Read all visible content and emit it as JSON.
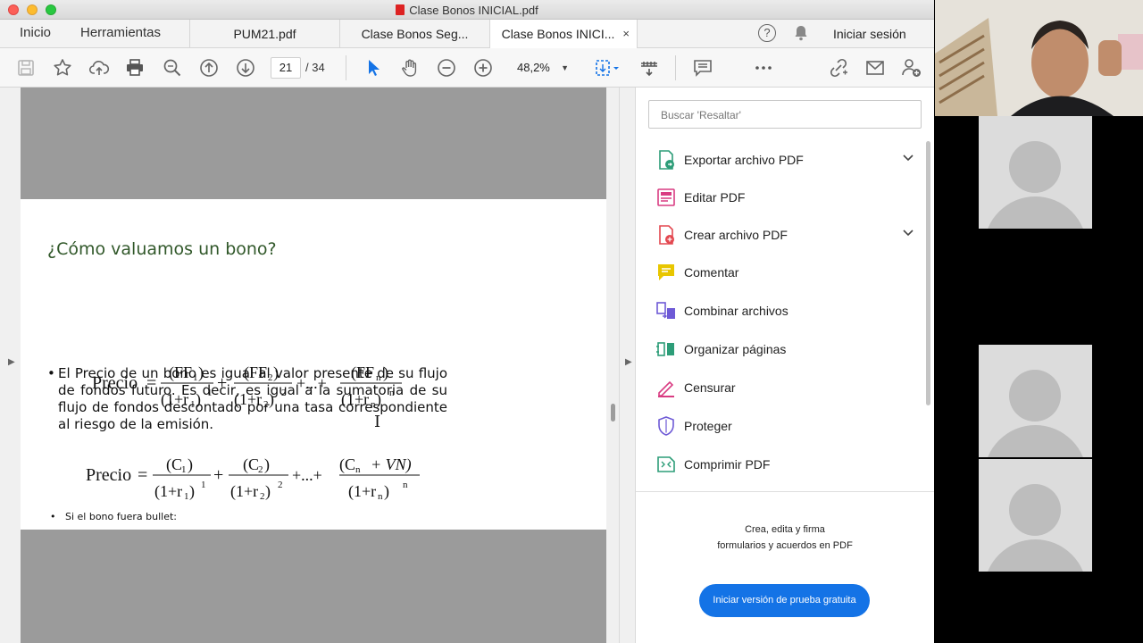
{
  "window": {
    "title": "Clase Bonos INICIAL.pdf"
  },
  "nav": {
    "home": "Inicio",
    "tools": "Herramientas"
  },
  "tabs": [
    {
      "label": "PUM21.pdf"
    },
    {
      "label": "Clase Bonos Seg..."
    },
    {
      "label": "Clase Bonos INICI...",
      "close": "×"
    }
  ],
  "account": {
    "signin": "Iniciar sesión",
    "help": "?"
  },
  "toolbar": {
    "page_current": "21",
    "page_total": "/ 34",
    "zoom": "48,2%"
  },
  "slide": {
    "title": "¿Cómo valuamos un bono?",
    "bullet_marker": "•",
    "bullet_text": "El Precio de un bono es igual al valor presente de su flujo de fondos futuro. Es decir, es igual a la sumatoria de su flujo de fondos descontado por una tasa correspondiente al riesgo de la emisión.",
    "small_bullet": "Si el bono fuera bullet:",
    "formula_label": "Precio",
    "f1": {
      "n1": "(FF",
      "s1": "1",
      "d1": "(1+r",
      "e1": "1"
    },
    "f1b": {
      "n2": "(FF",
      "s2": "2",
      "e2": "2"
    },
    "f1c": {
      "nn": "(FF",
      "sn": "n",
      "en": "n",
      "dots": "+...+"
    },
    "f2": {
      "c": "(C",
      "vn": "+ VN)"
    }
  },
  "panel": {
    "search_placeholder": "Buscar 'Resaltar'",
    "items": [
      {
        "label": "Exportar archivo PDF",
        "icon": "export-pdf-icon",
        "color": "#2d9d78"
      },
      {
        "label": "Editar PDF",
        "icon": "edit-pdf-icon",
        "color": "#d93c82"
      },
      {
        "label": "Crear archivo PDF",
        "icon": "create-pdf-icon",
        "color": "#e34850"
      },
      {
        "label": "Comentar",
        "icon": "comment-icon",
        "color": "#e8c600"
      },
      {
        "label": "Combinar archivos",
        "icon": "combine-icon",
        "color": "#6e5ad6"
      },
      {
        "label": "Organizar páginas",
        "icon": "organize-icon",
        "color": "#2d9d78"
      },
      {
        "label": "Censurar",
        "icon": "redact-icon",
        "color": "#d93c82"
      },
      {
        "label": "Proteger",
        "icon": "protect-icon",
        "color": "#6e5ad6"
      },
      {
        "label": "Comprimir PDF",
        "icon": "compress-icon",
        "color": "#2d9d78"
      }
    ],
    "promo_line1": "Crea, edita y firma",
    "promo_line2": "formularios y acuerdos en PDF",
    "trial_button": "Iniciar versión de prueba gratuita"
  }
}
